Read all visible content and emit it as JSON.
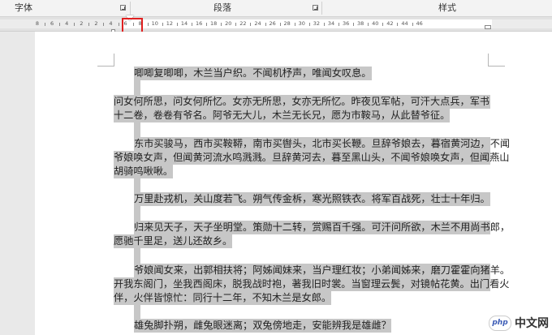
{
  "ribbon": {
    "groups": [
      {
        "label": "字体"
      },
      {
        "label": "段落"
      },
      {
        "label": "样式"
      }
    ]
  },
  "ruler": {
    "numbers": [
      "8",
      "6",
      "4",
      "2",
      "2",
      "4",
      "6",
      "8",
      "10",
      "12",
      "14",
      "16",
      "18",
      "20",
      "22",
      "24",
      "26",
      "28",
      "30",
      "32",
      "34",
      "36",
      "38",
      "40",
      "42",
      "44",
      "46"
    ]
  },
  "document": {
    "lines": [
      "唧唧复唧唧，木兰当户织。不闻机杼声，唯闻女叹息。",
      "问女何所思，问女何所忆。女亦无所思，女亦无所忆。昨夜见军帖，可汗大点兵，军书",
      "十二卷，卷卷有爷名。阿爷无大儿，木兰无长兄，愿为市鞍马，从此替爷征。",
      "东市买骏马，西市买鞍鞯，南市买辔头，北市买长鞭。旦辞爷娘去，暮宿黄河边，不闻",
      "爷娘唤女声，但闻黄河流水鸣溅溅。旦辞黄河去，暮至黑山头，不闻爷娘唤女声，但闻燕山",
      "胡骑鸣啾啾。",
      "万里赴戎机，关山度若飞。朔气传金柝，寒光照铁衣。将军百战死，壮士十年归。",
      "归来见天子，天子坐明堂。策勋十二转，赏赐百千强。可汗问所欲，木兰不用尚书郎，",
      "愿驰千里足，送儿还故乡。",
      "爷娘闻女来，出郭相扶将；阿姊闻妹来，当户理红妆；小弟闻姊来，磨刀霍霍向猪羊。",
      "开我东阁门，坐我西阁床，脱我战时袍，著我旧时裳。当窗理云鬓，对镜帖花黄。出门看火",
      "伴，火伴皆惊忙：同行十二年，不知木兰是女郎。",
      "雄兔脚扑朔，雌兔眼迷离；双兔傍地走，安能辨我是雄雌？"
    ]
  },
  "watermark": {
    "badge": "php",
    "text": "中文网"
  },
  "colors": {
    "selection": "#c7c7c7",
    "highlight_border": "#e02020",
    "spelling_underline": "#4a60c8"
  }
}
